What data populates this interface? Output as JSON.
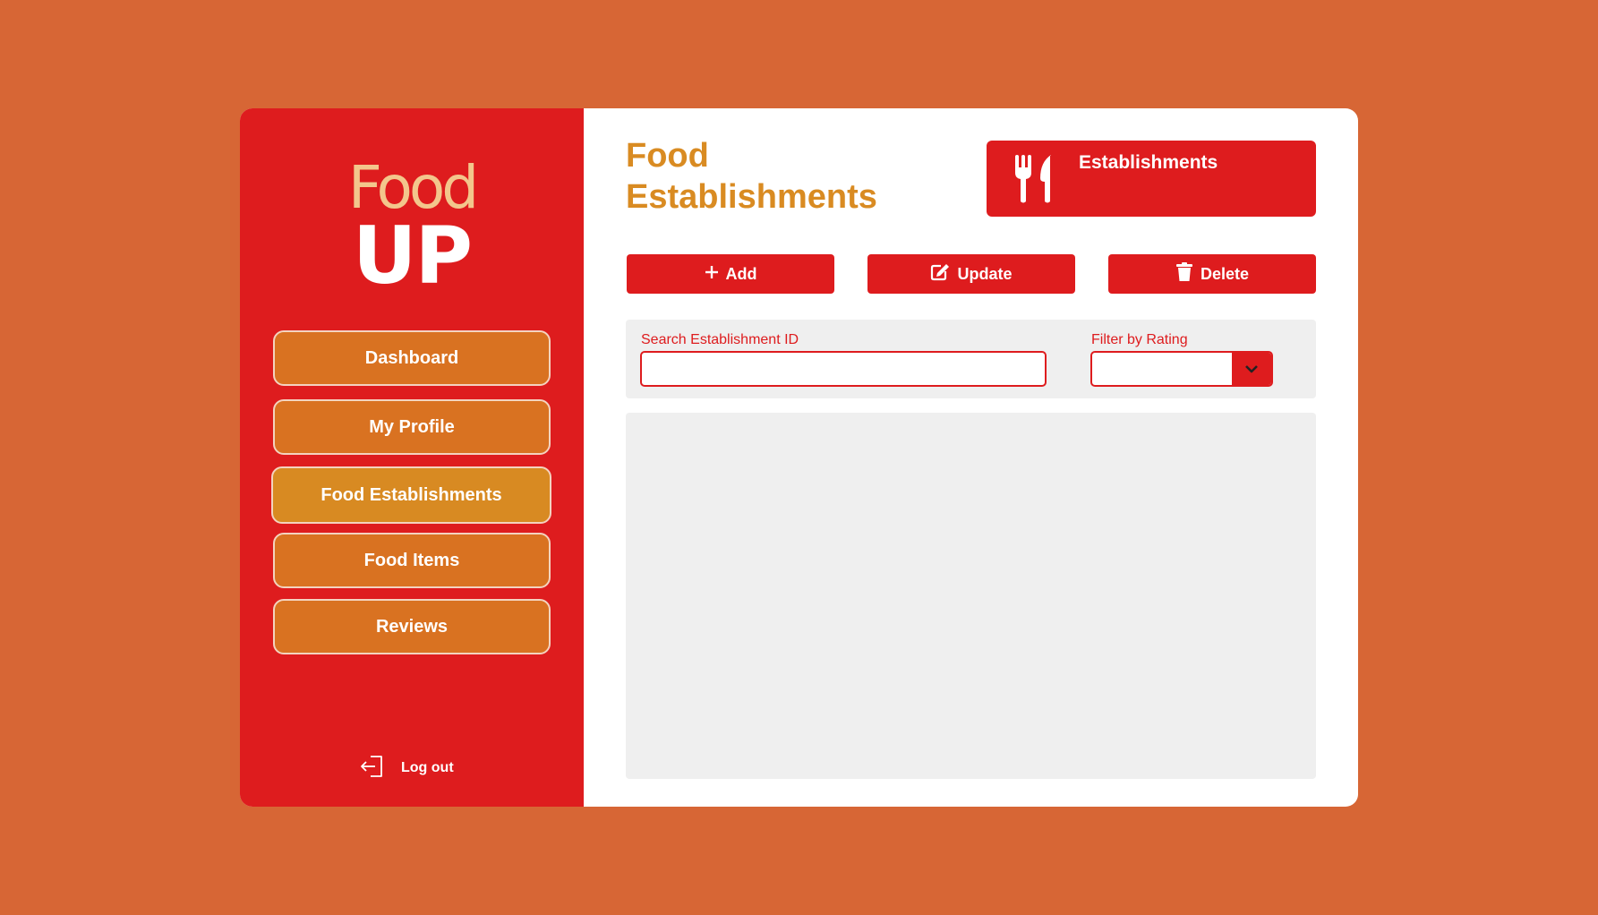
{
  "brand": {
    "line1": "Food",
    "line2": "UP"
  },
  "sidebar": {
    "items": [
      {
        "label": "Dashboard",
        "active": false
      },
      {
        "label": "My Profile",
        "active": false
      },
      {
        "label": "Food Establishments",
        "active": true
      },
      {
        "label": "Food Items",
        "active": false
      },
      {
        "label": "Reviews",
        "active": false
      }
    ],
    "logout_label": "Log out",
    "logout_icon": "logout-icon"
  },
  "header": {
    "title": "Food Establishments",
    "card_label": "Establishments",
    "card_icon": "fork-knife-icon"
  },
  "toolbar": {
    "add_label": "Add",
    "update_label": "Update",
    "delete_label": "Delete"
  },
  "filters": {
    "search_label": "Search Establishment ID",
    "search_value": "",
    "rating_label": "Filter by Rating",
    "rating_value": ""
  },
  "colors": {
    "background": "#d76635",
    "sidebar": "#de1c1e",
    "accent": "#d98b22",
    "nav_button": "#d97221",
    "nav_active": "#d88a22"
  }
}
